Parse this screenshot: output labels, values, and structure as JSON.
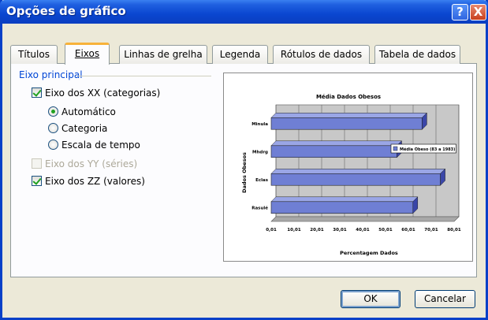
{
  "window": {
    "title": "Opções de gráfico",
    "help": "?",
    "close": "X"
  },
  "tabs": [
    {
      "label": "Títulos",
      "active": false
    },
    {
      "label": "Eixos",
      "active": true
    },
    {
      "label": "Linhas de grelha",
      "active": false
    },
    {
      "label": "Legenda",
      "active": false
    },
    {
      "label": "Rótulos de dados",
      "active": false
    },
    {
      "label": "Tabela de dados",
      "active": false
    }
  ],
  "axes": {
    "group_label": "Eixo principal",
    "x_axis": {
      "label": "Eixo dos XX (categorias)",
      "checked": true
    },
    "auto": {
      "label": "Automático",
      "selected": true
    },
    "category": {
      "label": "Categoria",
      "selected": false
    },
    "timescale": {
      "label": "Escala de tempo",
      "selected": false
    },
    "y_axis": {
      "label": "Eixo dos YY (séries)",
      "checked": false,
      "disabled": true
    },
    "z_axis": {
      "label": "Eixo dos ZZ (valores)",
      "checked": true
    }
  },
  "buttons": {
    "ok": "OK",
    "cancel": "Cancelar"
  },
  "chart_data": {
    "type": "bar",
    "orientation": "horizontal",
    "title": "Média Dados Obesos",
    "xlabel": "Percentagem Dados",
    "ylabel": "Dados Obesos",
    "categories": [
      "Rasulé",
      "Eclas",
      "Mhdrg",
      "Minula"
    ],
    "series": [
      {
        "name": "Média Obeso (83 a 1983)",
        "values": [
          62,
          74,
          55,
          66
        ]
      }
    ],
    "xlim": [
      0,
      80
    ],
    "ticks": [
      "0,01",
      "10,01",
      "20,01",
      "30,01",
      "40,01",
      "50,01",
      "60,01",
      "70,01",
      "80,01"
    ],
    "colors": {
      "bar": "#6f7fd4",
      "bar_top": "#9aa6e6",
      "bar_side": "#3a46a8"
    },
    "grid": true,
    "legend": "inside"
  }
}
